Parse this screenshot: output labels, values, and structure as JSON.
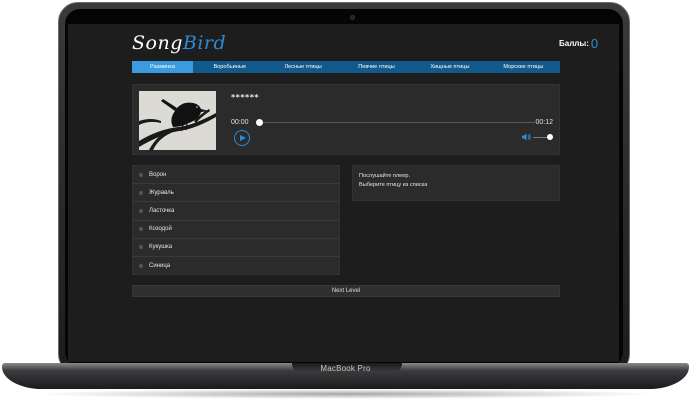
{
  "device": {
    "label": "MacBook Pro"
  },
  "app": {
    "logo": {
      "part1": "Song",
      "part2": "Bird"
    },
    "score": {
      "label": "Баллы:",
      "value": "0"
    }
  },
  "nav": {
    "items": [
      {
        "label": "Разминка",
        "active": true
      },
      {
        "label": "Воробьиные",
        "active": false
      },
      {
        "label": "Лесные птицы",
        "active": false
      },
      {
        "label": "Певчие птицы",
        "active": false
      },
      {
        "label": "Хищные птицы",
        "active": false
      },
      {
        "label": "Морские птицы",
        "active": false
      }
    ]
  },
  "player": {
    "hidden_name": "******",
    "current_time": "00:00",
    "duration": "00:12",
    "progress": 0,
    "volume": 0.85
  },
  "answers": {
    "items": [
      {
        "label": "Ворон"
      },
      {
        "label": "Журавль"
      },
      {
        "label": "Ласточка"
      },
      {
        "label": "Козодой"
      },
      {
        "label": "Кукушка"
      },
      {
        "label": "Синица"
      }
    ]
  },
  "info": {
    "line1": "Послушайте плеер.",
    "line2": "Выберите птицу из списка"
  },
  "next_level": {
    "label": "Next Level"
  },
  "colors": {
    "accent": "#2b8bd6",
    "nav_bg": "#135a8c",
    "nav_active": "#3a9be0",
    "panel_bg": "#2b2b2b",
    "screen_bg": "#1d1d1d"
  }
}
